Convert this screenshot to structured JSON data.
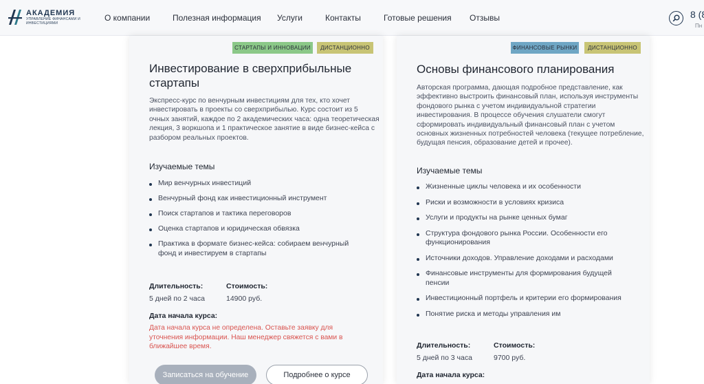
{
  "header": {
    "logo_title": "АКАДЕМИЯ",
    "logo_subtitle": "управление финансами и инвестициями",
    "nav": [
      "О компании",
      "Полезная информация",
      "Услуги",
      "Контакты",
      "Готовые решения",
      "Отзывы"
    ],
    "phone": "8 (8",
    "phone_sub": "Пн"
  },
  "course_left": {
    "tags": [
      "СТАРТАПЫ И ИННОВАЦИИ",
      "ДИСТАНЦИОННО"
    ],
    "title": "Инвестирование в сверхприбыльные стартапы",
    "description": "Экспресс-курс по венчурным инвестициям для тех, кто хочет инвестировать в проекты со сверхприбылью. Курс состоит из 5 очных занятий, каждое по 2 академических часа: одна теоретическая лекция, 3 воркшопа и 1 практическое занятие в виде бизнес-кейса с разбором реальных проектов.",
    "topics_heading": "Изучаемые темы",
    "topics": [
      "Мир венчурных инвестиций",
      "Венчурный фонд как инвестиционный инструмент",
      "Поиск стартапов и тактика переговоров",
      "Оценка стартапов и юридическая обвязка",
      "Практика в формате бизнес-кейса: собираем венчурный фонд и инвестируем в стартапы"
    ],
    "duration_label": "Длительность:",
    "duration": "5 дней по 2 часа",
    "price_label": "Стоимость:",
    "price": "14900 руб.",
    "start_label": "Дата начала курса:",
    "start_notice": "Дата начала курса не определена. Оставьте заявку для уточнения информации. Наш менеджер свяжется с вами в ближайшее время.",
    "enroll_button": "Записаться на обучение",
    "details_button": "Подробнее о курсе"
  },
  "course_right": {
    "tags": [
      "ФИНАНСОВЫЕ РЫНКИ",
      "ДИСТАНЦИОННО"
    ],
    "title": "Основы финансового планирования",
    "description": "Авторская программа, дающая подробное представление, как эффективно выстроить финансовый план, используя инструменты фондового рынка с учетом индивидуальной стратегии инвестирования. В процессе обучения слушатели смогут сформировать индивидуальный финансовый план с учетом основных жизненных потребностей человека (текущее потребление, будущая пенсия, образование детей и прочее).",
    "topics_heading": "Изучаемые темы",
    "topics": [
      "Жизненные циклы человека и их особенности",
      "Риски и возможности в условиях кризиса",
      "Услуги и продукты на рынке ценных бумаг",
      "Структура фондового рынка России. Особенности его функционирования",
      "Источники доходов. Управление доходами и расходами",
      "Финансовые инструменты для формирования будущей пенсии",
      "Инвестиционный портфель и критерии его формирования",
      "Понятие риска и методы управления им"
    ],
    "duration_label": "Длительность:",
    "duration": "5 дней по 3 часа",
    "price_label": "Стоимость:",
    "price": "9700 руб.",
    "start_label": "Дата начала курса:"
  },
  "colors": {
    "tag_green": "#8bc888",
    "tag_olive": "#c8c475",
    "tag_blue": "#6fa6c4",
    "warning": "#d9534f",
    "brand": "#1f3550"
  }
}
